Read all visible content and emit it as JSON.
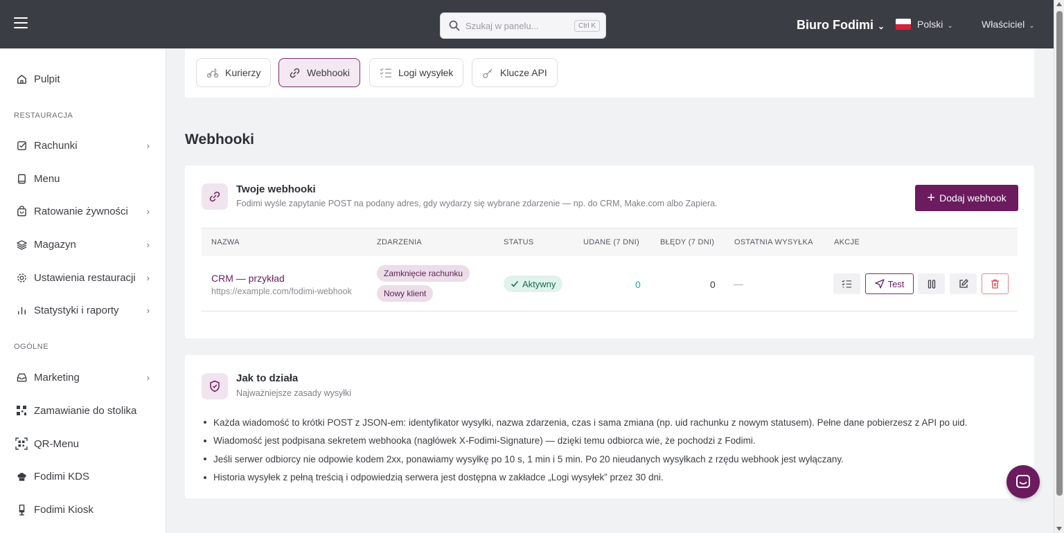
{
  "topbar": {
    "search": {
      "placeholder": "Szukaj w panelu...",
      "shortcut": "Ctrl K"
    },
    "org_name": "Biuro Fodimi",
    "language": "Polski",
    "role": "Właściciel"
  },
  "sidebar": {
    "items": [
      {
        "label": "Pulpit",
        "icon": "home-icon"
      },
      {
        "label": "Rachunki",
        "icon": "receipt-check-icon",
        "has_submenu": true
      },
      {
        "label": "Menu",
        "icon": "book-icon"
      },
      {
        "label": "Ratowanie żywności",
        "icon": "bag-icon",
        "has_submenu": true
      },
      {
        "label": "Magazyn",
        "icon": "layers-icon",
        "has_submenu": true
      },
      {
        "label": "Ustawienia restauracji",
        "icon": "gear-icon",
        "has_submenu": true
      },
      {
        "label": "Statystyki i raporty",
        "icon": "bar-chart-icon",
        "has_submenu": true
      },
      {
        "label": "Marketing",
        "icon": "inbox-icon",
        "has_submenu": true
      },
      {
        "label": "Zamawianie do stolika",
        "icon": "qr-grid-icon"
      },
      {
        "label": "QR-Menu",
        "icon": "qr-scan-icon"
      },
      {
        "label": "Fodimi KDS",
        "icon": "chef-hat-icon"
      },
      {
        "label": "Fodimi Kiosk",
        "icon": "kiosk-icon"
      }
    ],
    "sections": {
      "restaurant": "RESTAURACJA",
      "general": "OGÓLNE"
    }
  },
  "tabs": [
    {
      "label": "Kurierzy",
      "icon": "scooter-icon",
      "active": false
    },
    {
      "label": "Webhooki",
      "icon": "link-icon",
      "active": true
    },
    {
      "label": "Logi wysyłek",
      "icon": "checklist-icon",
      "active": false
    },
    {
      "label": "Klucze API",
      "icon": "key-icon",
      "active": false
    }
  ],
  "page_title": "Webhooki",
  "webhooks_card": {
    "title": "Twoje webhooki",
    "subtitle": "Fodimi wyśle zapytanie POST na podany adres, gdy wydarzy się wybrane zdarzenie — np. do CRM, Make.com albo Zapiera.",
    "add_button": "Dodaj webhook",
    "columns": [
      "NAZWA",
      "ZDARZENIA",
      "STATUS",
      "UDANE (7 DNI)",
      "BŁĘDY (7 DNI)",
      "OSTATNIA WYSYŁKA",
      "AKCJE"
    ],
    "rows": [
      {
        "name": "CRM — przykład",
        "url": "https://example.com/fodimi-webhook",
        "events": [
          "Zamknięcie rachunku",
          "Nowy klient"
        ],
        "status": "Aktywny",
        "success_7d": "0",
        "errors_7d": "0",
        "last_sent": "—",
        "test_label": "Test"
      }
    ]
  },
  "how_card": {
    "title": "Jak to działa",
    "subtitle": "Najważniejsze zasady wysyłki",
    "bullets": [
      "Każda wiadomość to krótki POST z JSON-em: identyfikator wysyłki, nazwa zdarzenia, czas i sama zmiana (np. uid rachunku z nowym statusem). Pełne dane pobierzesz z API po uid.",
      "Wiadomość jest podpisana sekretem webhooka (nagłówek X-Fodimi-Signature) — dzięki temu odbiorca wie, że pochodzi z Fodimi.",
      "Jeśli serwer odbiorcy nie odpowie kodem 2xx, ponawiamy wysyłkę po 10 s, 1 min i 5 min. Po 20 nieudanych wysyłkach z rzędu webhook jest wyłączany.",
      "Historia wysyłek z pełną treścią i odpowiedzią serwera jest dostępna w zakładce „Logi wysyłek” przez 30 dni."
    ]
  },
  "colors": {
    "brand": "#6b1b5e",
    "topbar": "#3a3e44",
    "success": "#1fa6a0"
  }
}
